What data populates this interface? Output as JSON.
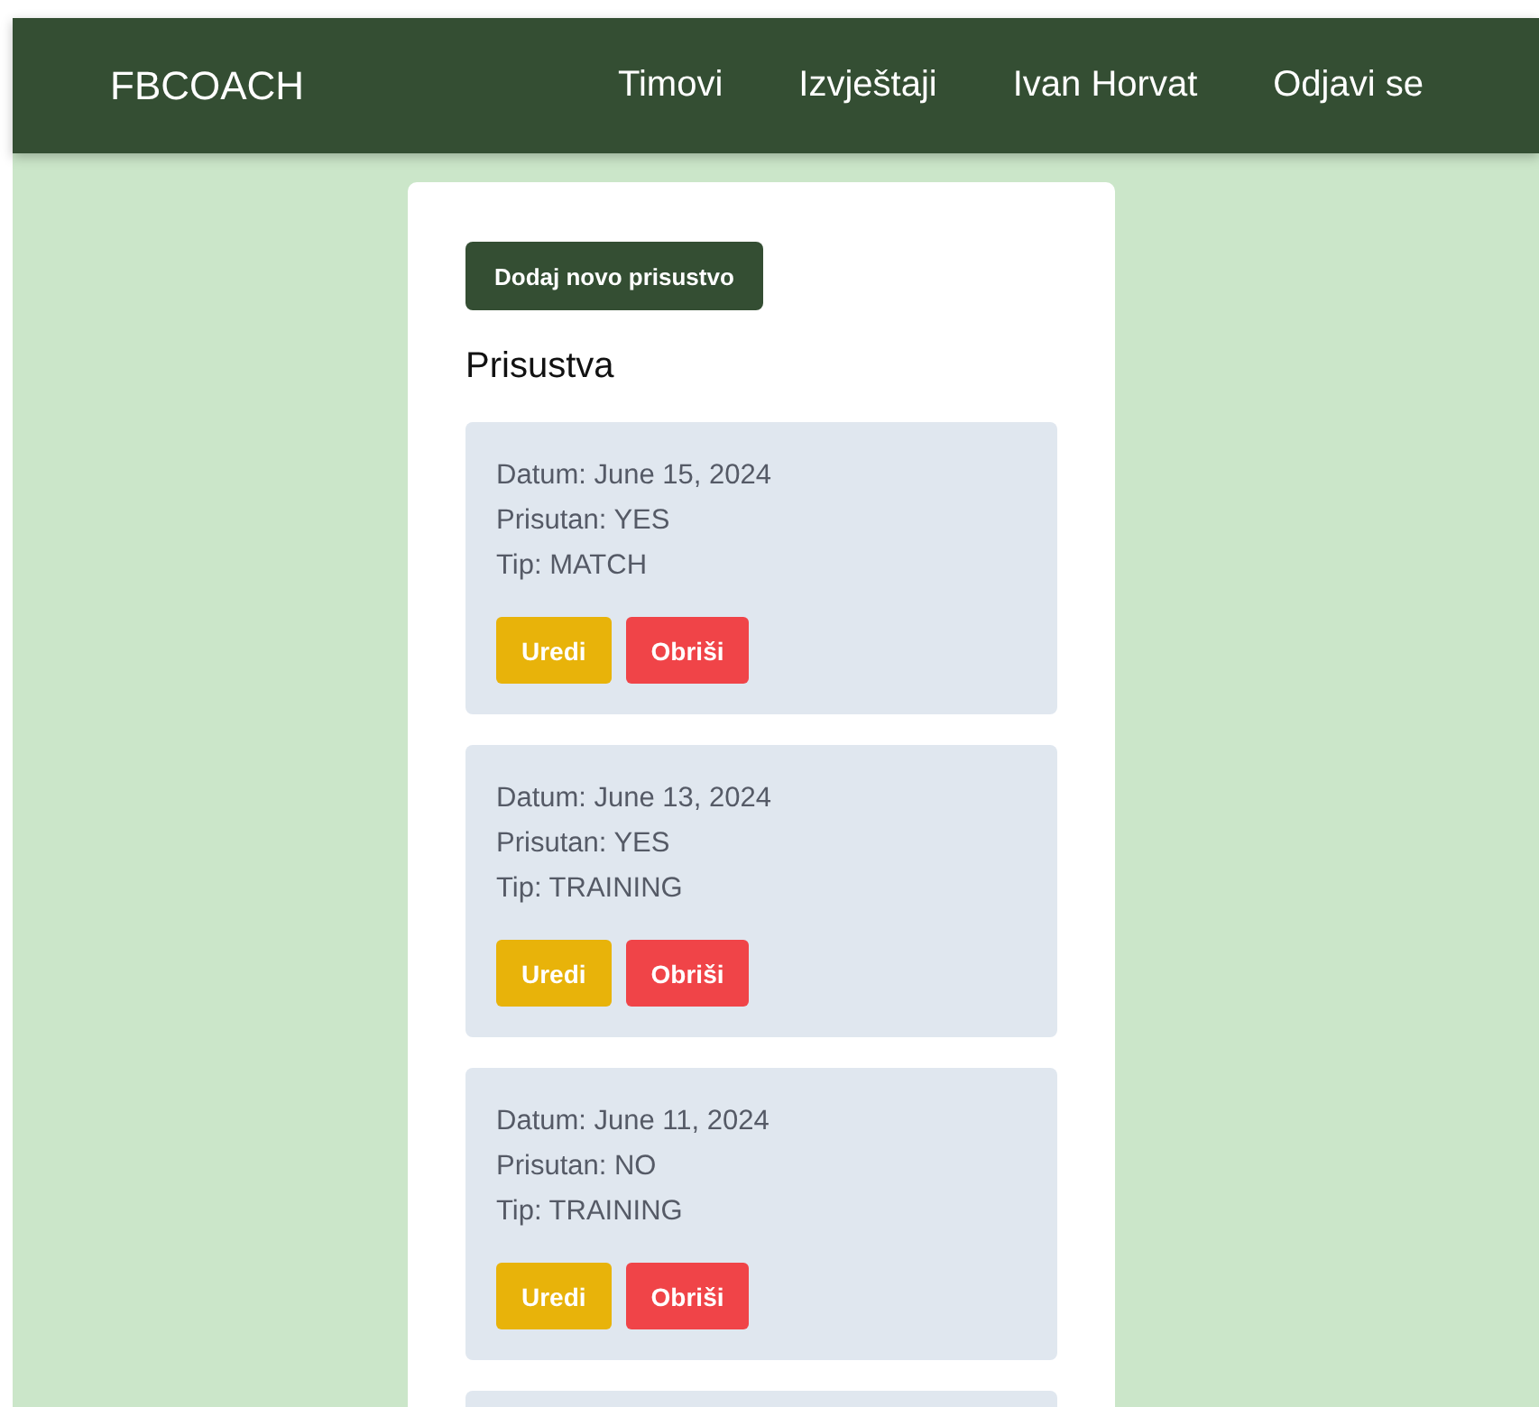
{
  "navbar": {
    "brand": "FBCOACH",
    "links": [
      "Timovi",
      "Izvještaji",
      "Ivan Horvat",
      "Odjavi se"
    ]
  },
  "add_button": "Dodaj novo prisustvo",
  "heading": "Prisustva",
  "entries": [
    {
      "date": "Datum: June 15, 2024",
      "present": "Prisutan: YES",
      "type": "Tip: MATCH",
      "edit": "Uredi",
      "delete": "Obriši"
    },
    {
      "date": "Datum: June 13, 2024",
      "present": "Prisutan: YES",
      "type": "Tip: TRAINING",
      "edit": "Uredi",
      "delete": "Obriši"
    },
    {
      "date": "Datum: June 11, 2024",
      "present": "Prisutan: NO",
      "type": "Tip: TRAINING",
      "edit": "Uredi",
      "delete": "Obriši"
    }
  ]
}
